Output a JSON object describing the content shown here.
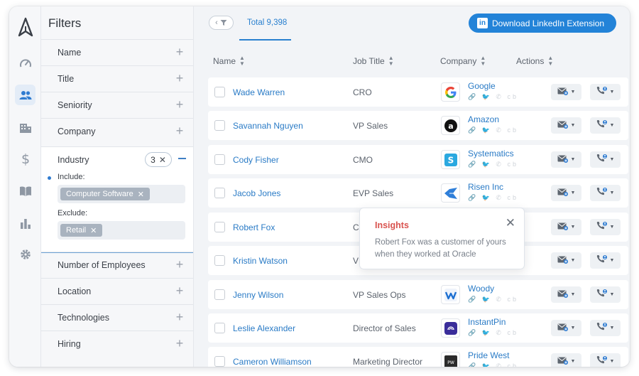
{
  "rail": {
    "items": [
      {
        "icon": "logo-icon"
      },
      {
        "icon": "dashboard-gauge-icon"
      },
      {
        "icon": "people-icon",
        "active": true
      },
      {
        "icon": "building-icon"
      },
      {
        "icon": "dollar-icon"
      },
      {
        "icon": "book-icon"
      },
      {
        "icon": "bar-chart-icon"
      },
      {
        "icon": "gear-icon"
      }
    ]
  },
  "filters": {
    "title": "Filters",
    "top_items": [
      "Name",
      "Title",
      "Seniority",
      "Company"
    ],
    "industry": {
      "label": "Industry",
      "count": "3",
      "include_label": "Include:",
      "include_tags": [
        "Computer Software"
      ],
      "exclude_label": "Exclude:",
      "exclude_tags": [
        "Retail"
      ]
    },
    "bottom_items": [
      "Number of Employees",
      "Location",
      "Technologies",
      "Hiring"
    ]
  },
  "toolbar": {
    "total_label": "Total 9,398",
    "download_label": "Download LinkedIn Extension"
  },
  "table": {
    "columns": [
      "Name",
      "Job Title",
      "Company",
      "Actions"
    ],
    "rows": [
      {
        "name": "Wade Warren",
        "title": "CRO",
        "company": "Google",
        "logo": "google"
      },
      {
        "name": "Savannah Nguyen",
        "title": "VP Sales",
        "company": "Amazon",
        "logo": "amazon"
      },
      {
        "name": "Cody Fisher",
        "title": "CMO",
        "company": "Systematics",
        "logo": "systematics"
      },
      {
        "name": "Jacob Jones",
        "title": "EVP Sales",
        "company": "Risen Inc",
        "logo": "risen"
      },
      {
        "name": "Robert Fox",
        "title": "C",
        "company": "",
        "logo": ""
      },
      {
        "name": "Kristin Watson",
        "title": "V",
        "company": "",
        "logo": ""
      },
      {
        "name": "Jenny Wilson",
        "title": "VP Sales Ops",
        "company": "Woody",
        "logo": "woody"
      },
      {
        "name": "Leslie Alexander",
        "title": "Director of Sales",
        "company": "InstantPin",
        "logo": "instantpin"
      },
      {
        "name": "Cameron Williamson",
        "title": "Marketing Director",
        "company": "Pride West",
        "logo": "pridewest"
      }
    ]
  },
  "insight": {
    "title": "Insights",
    "text": "Robert Fox was a customer of yours when they worked at Oracle"
  },
  "colors": {
    "accent": "#2383d8",
    "link": "#2a7bc6",
    "insight_title": "#d9534f"
  }
}
